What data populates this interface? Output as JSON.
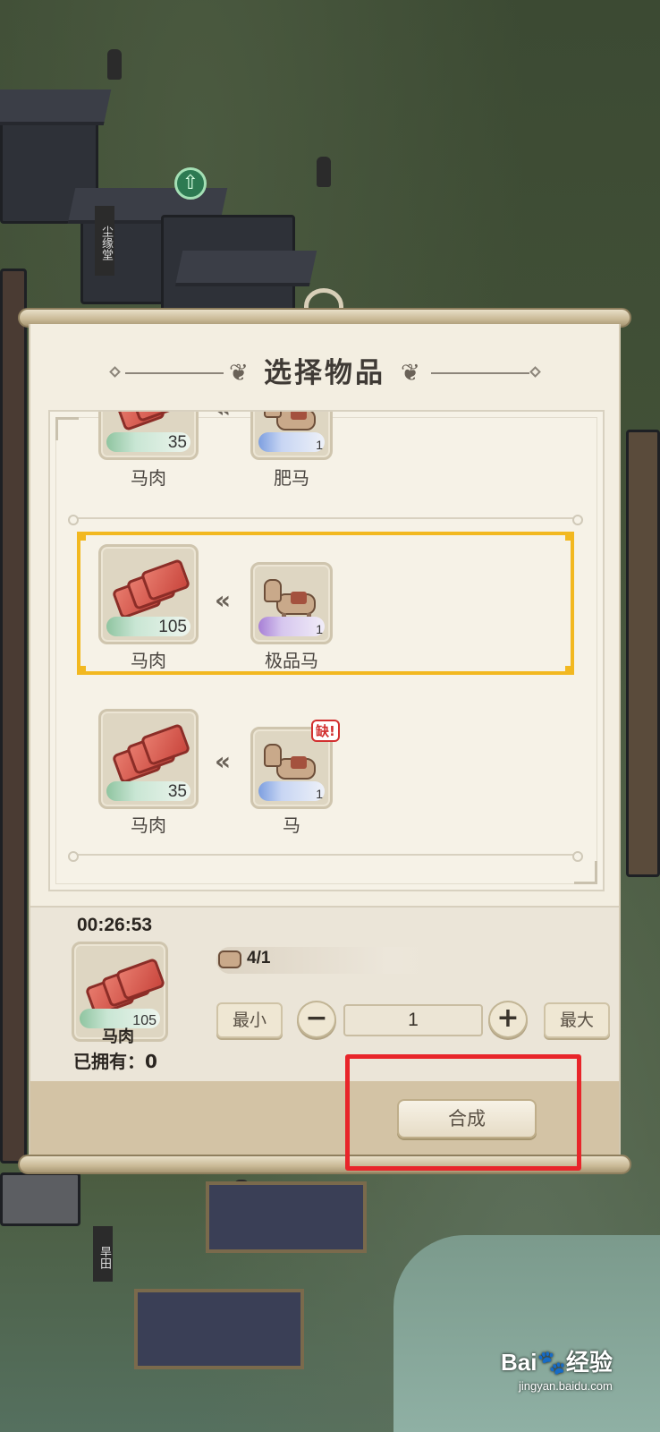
{
  "dialog": {
    "title": "选择物品"
  },
  "recipes": [
    {
      "ingredient": {
        "name": "马肉",
        "count": "35"
      },
      "product": {
        "name": "肥马",
        "count": "1"
      }
    },
    {
      "ingredient": {
        "name": "马肉",
        "count": "105"
      },
      "product": {
        "name": "极品马",
        "count": "1"
      },
      "selected": true
    },
    {
      "ingredient": {
        "name": "马肉",
        "count": "35"
      },
      "product": {
        "name": "马",
        "count": "1",
        "tag": "缺!"
      }
    }
  ],
  "detail": {
    "timer": "00:26:53",
    "item_name": "马肉",
    "item_count": "105",
    "owned": "已拥有：0",
    "requirement": "4/1",
    "min_label": "最小",
    "max_label": "最大",
    "minus": "−",
    "plus": "+",
    "quantity": "1",
    "craft_label": "合成"
  },
  "map": {
    "sign1": "尘缘堂",
    "sign2": "旱田"
  },
  "watermark": {
    "brand": "Bai🐾经验",
    "url": "jingyan.baidu.com"
  },
  "colors": {
    "selected_border": "#f2b820",
    "highlight_box": "#e8252a",
    "panel_bg": "#f3eee1"
  }
}
